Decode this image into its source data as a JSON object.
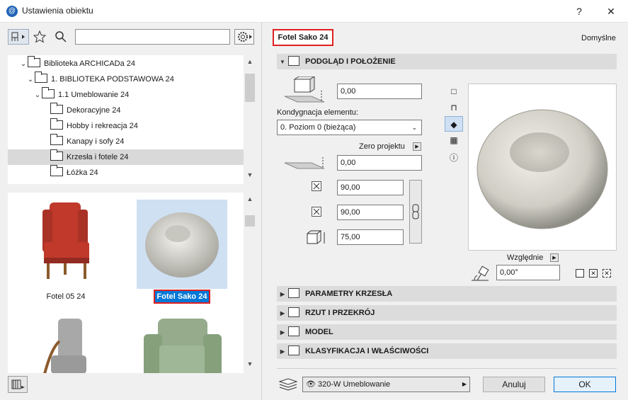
{
  "window": {
    "title": "Ustawienia obiektu",
    "help": "?",
    "close": "✕"
  },
  "library": {
    "search_value": "",
    "tree": [
      {
        "label": "Biblioteka ARCHICADa 24",
        "chevron": "v"
      },
      {
        "label": "1. BIBLIOTEKA PODSTAWOWA 24",
        "chevron": "v"
      },
      {
        "label": "1.1 Umeblowanie 24",
        "chevron": "v"
      },
      {
        "label": "Dekoracyjne 24",
        "chevron": ""
      },
      {
        "label": "Hobby i rekreacja 24",
        "chevron": ""
      },
      {
        "label": "Kanapy i sofy 24",
        "chevron": ""
      },
      {
        "label": "Krzesła i fotele 24",
        "chevron": "",
        "selected": true
      },
      {
        "label": "Łóżka 24",
        "chevron": ""
      }
    ],
    "thumbnails": [
      {
        "label": "Fotel 05 24",
        "selected": false,
        "color": "#c0392b"
      },
      {
        "label": "Fotel Sako 24",
        "selected": true,
        "color": "#e7e6df"
      },
      {
        "label": "",
        "selected": false,
        "color": "#a8a8a8"
      },
      {
        "label": "",
        "selected": false,
        "color": "#95ab8b"
      }
    ]
  },
  "object": {
    "name": "Fotel Sako 24",
    "defaults_label": "Domyślne"
  },
  "panels": {
    "preview_position": "PODGLĄD I POŁOŻENIE",
    "chair_params": "PARAMETRY KRZESŁA",
    "plan_section": "RZUT I PRZEKRÓJ",
    "model": "MODEL",
    "classification": "KLASYFIKACJA I WŁAŚCIWOŚCI"
  },
  "position": {
    "elevation": "0,00",
    "story_label": "Kondygnacja elementu:",
    "story_value": "0. Poziom 0 (bieżąca)",
    "zero_label": "Zero projektu",
    "zero_value": "0,00",
    "width": "90,00",
    "depth": "90,00",
    "height": "75,00",
    "relative_label": "Względnie",
    "angle": "0,00°"
  },
  "footer": {
    "layer": "320-W Umeblowanie",
    "cancel": "Anuluj",
    "ok": "OK"
  },
  "colors": {
    "accent_red": "#e02020",
    "selection_blue": "#cfe0f3",
    "primary_blue": "#0078d7"
  }
}
